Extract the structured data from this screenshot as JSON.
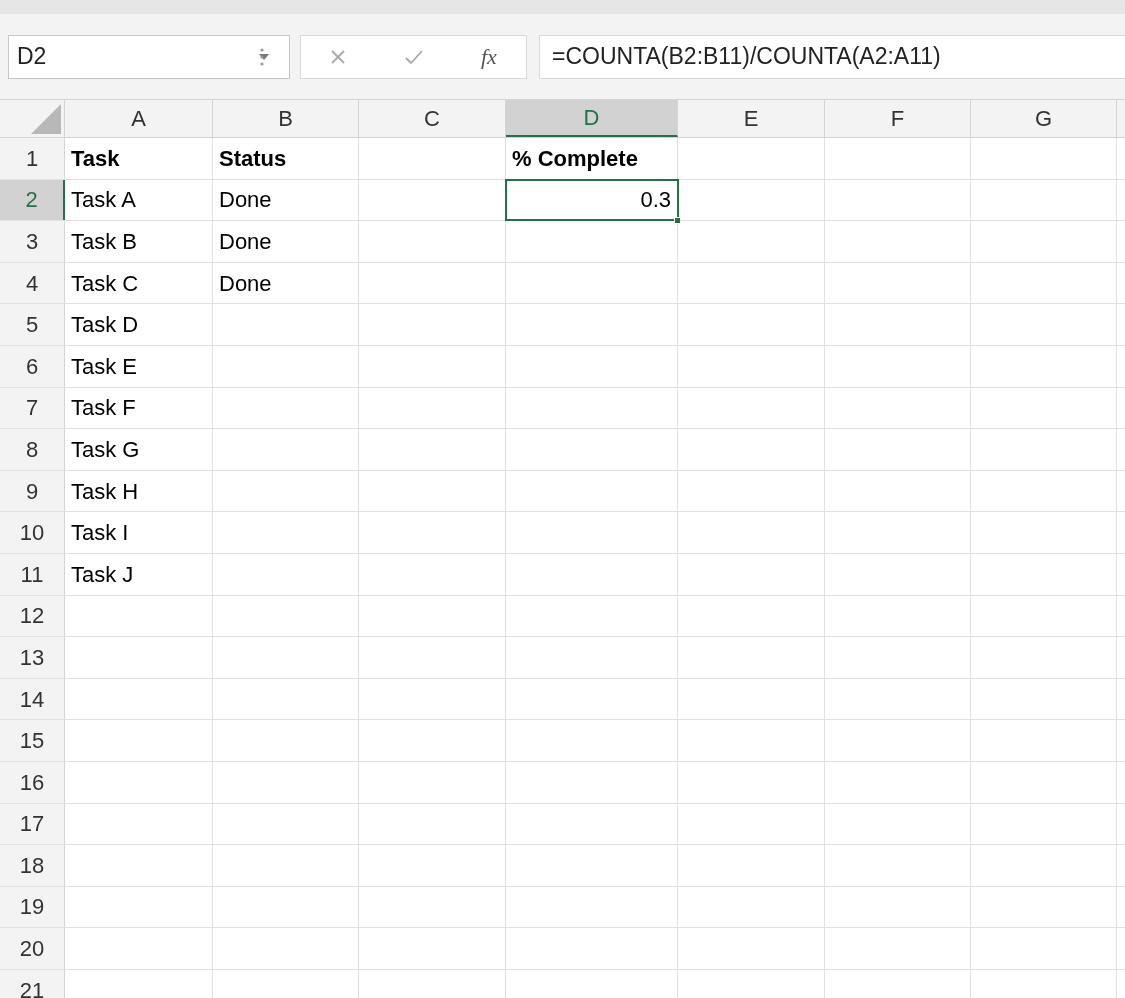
{
  "formula_bar": {
    "name_box": "D2",
    "function_label": "fx",
    "formula": "=COUNTA(B2:B11)/COUNTA(A2:A11)"
  },
  "columns": [
    {
      "label": "A",
      "selected": false
    },
    {
      "label": "B",
      "selected": false
    },
    {
      "label": "C",
      "selected": false
    },
    {
      "label": "D",
      "selected": true
    },
    {
      "label": "E",
      "selected": false
    },
    {
      "label": "F",
      "selected": false
    },
    {
      "label": "G",
      "selected": false
    }
  ],
  "rows": [
    {
      "label": "1",
      "selected": false,
      "cells": {
        "A": {
          "text": "Task",
          "bold": true,
          "kind": "text",
          "selected": false
        },
        "B": {
          "text": "Status",
          "bold": true,
          "kind": "text",
          "selected": false
        },
        "D": {
          "text": "% Complete",
          "bold": true,
          "kind": "text",
          "selected": false
        }
      }
    },
    {
      "label": "2",
      "selected": true,
      "cells": {
        "A": {
          "text": "Task A",
          "bold": false,
          "kind": "text",
          "selected": false
        },
        "B": {
          "text": "Done",
          "bold": false,
          "kind": "text",
          "selected": false
        },
        "D": {
          "text": "0.3",
          "bold": false,
          "kind": "number",
          "selected": true
        }
      }
    },
    {
      "label": "3",
      "selected": false,
      "cells": {
        "A": {
          "text": "Task B",
          "bold": false,
          "kind": "text",
          "selected": false
        },
        "B": {
          "text": "Done",
          "bold": false,
          "kind": "text",
          "selected": false
        }
      }
    },
    {
      "label": "4",
      "selected": false,
      "cells": {
        "A": {
          "text": "Task C",
          "bold": false,
          "kind": "text",
          "selected": false
        },
        "B": {
          "text": "Done",
          "bold": false,
          "kind": "text",
          "selected": false
        }
      }
    },
    {
      "label": "5",
      "selected": false,
      "cells": {
        "A": {
          "text": "Task D",
          "bold": false,
          "kind": "text",
          "selected": false
        }
      }
    },
    {
      "label": "6",
      "selected": false,
      "cells": {
        "A": {
          "text": "Task E",
          "bold": false,
          "kind": "text",
          "selected": false
        }
      }
    },
    {
      "label": "7",
      "selected": false,
      "cells": {
        "A": {
          "text": "Task F",
          "bold": false,
          "kind": "text",
          "selected": false
        }
      }
    },
    {
      "label": "8",
      "selected": false,
      "cells": {
        "A": {
          "text": "Task G",
          "bold": false,
          "kind": "text",
          "selected": false
        }
      }
    },
    {
      "label": "9",
      "selected": false,
      "cells": {
        "A": {
          "text": "Task H",
          "bold": false,
          "kind": "text",
          "selected": false
        }
      }
    },
    {
      "label": "10",
      "selected": false,
      "cells": {
        "A": {
          "text": "Task I",
          "bold": false,
          "kind": "text",
          "selected": false
        }
      }
    },
    {
      "label": "11",
      "selected": false,
      "cells": {
        "A": {
          "text": "Task J",
          "bold": false,
          "kind": "text",
          "selected": false
        }
      }
    },
    {
      "label": "12",
      "selected": false,
      "cells": {}
    },
    {
      "label": "13",
      "selected": false,
      "cells": {}
    },
    {
      "label": "14",
      "selected": false,
      "cells": {}
    },
    {
      "label": "15",
      "selected": false,
      "cells": {}
    },
    {
      "label": "16",
      "selected": false,
      "cells": {}
    },
    {
      "label": "17",
      "selected": false,
      "cells": {}
    },
    {
      "label": "18",
      "selected": false,
      "cells": {}
    },
    {
      "label": "19",
      "selected": false,
      "cells": {}
    },
    {
      "label": "20",
      "selected": false,
      "cells": {}
    },
    {
      "label": "21",
      "selected": false,
      "cells": {}
    }
  ]
}
